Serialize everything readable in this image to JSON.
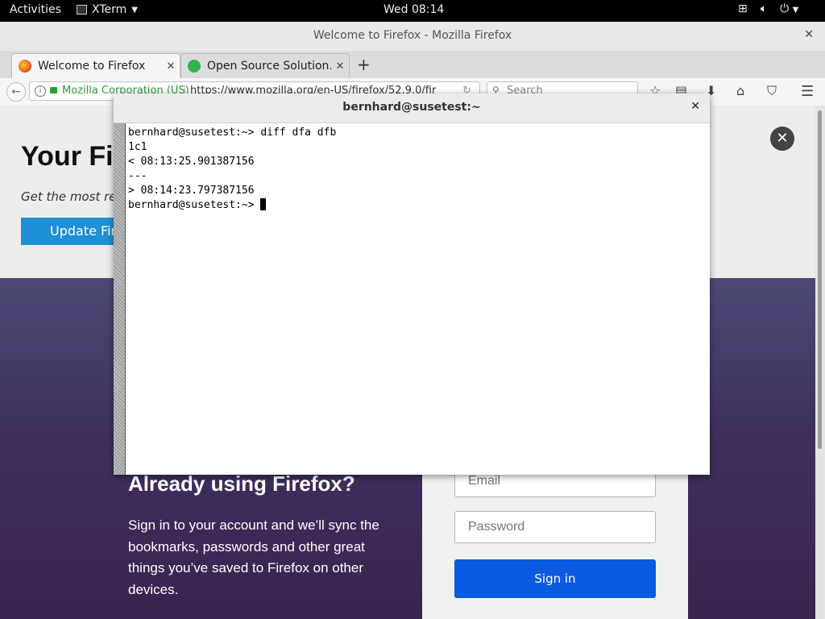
{
  "topbar": {
    "activities": "Activities",
    "app_name": "XTerm",
    "clock": "Wed 08:14"
  },
  "firefox": {
    "window_title": "Welcome to Firefox - Mozilla Firefox",
    "tabs": [
      {
        "label": "Welcome to Firefox",
        "active": true
      },
      {
        "label": "Open Source Solution...",
        "active": false
      }
    ],
    "url_org": "Mozilla Corporation (US)",
    "url": "https://www.mozilla.org/en-US/firefox/52.9.0/fir",
    "search_placeholder": "Search"
  },
  "page": {
    "hero_title": "Your Fi",
    "hero_sub": "Get the most rec",
    "update_button": "Update Fire",
    "already_heading": "Already using Firefox?",
    "signin_text": "Sign in to your account and we’ll sync the bookmarks, passwords and other great things you’ve saved to Firefox on other devices.",
    "email_placeholder": "Email",
    "password_placeholder": "Password",
    "signin_button": "Sign in"
  },
  "xterm": {
    "title": "bernhard@susetest:~",
    "lines": [
      "bernhard@susetest:~> diff dfa dfb",
      "1c1",
      "< 08:13:25.901387156",
      "---",
      "> 08:14:23.797387156",
      "bernhard@susetest:~> "
    ]
  }
}
